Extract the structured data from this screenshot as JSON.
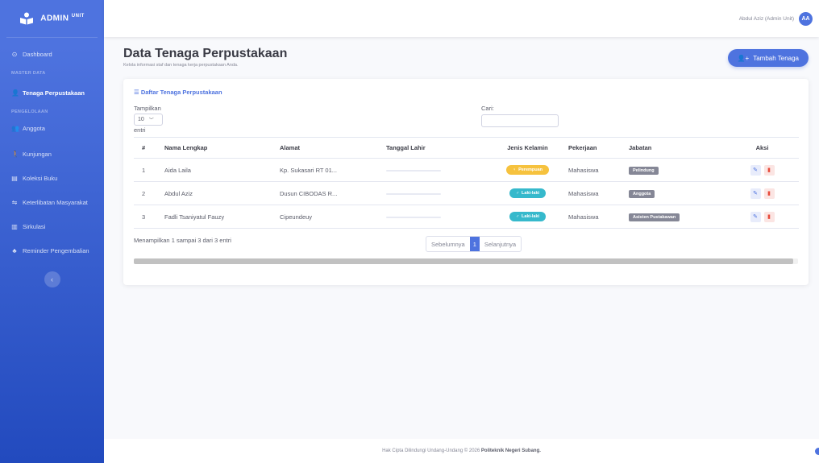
{
  "brand": {
    "name": "ADMIN",
    "suffix": "UNIT"
  },
  "sidebar": {
    "dashboard": "Dashboard",
    "heading_master": "MASTER DATA",
    "tenaga": "Tenaga Perpustakaan",
    "heading_pengelolaan": "PENGELOLAAN",
    "items": [
      "Anggota",
      "Kunjungan",
      "Koleksi Buku",
      "Keterlibatan Masyarakat",
      "Sirkulasi",
      "Reminder Pengembalian"
    ]
  },
  "topbar": {
    "user_name": "Abdul Aziz (Admin Unit)",
    "avatar": "AA"
  },
  "page": {
    "title": "Data Tenaga Perpustakaan",
    "subtitle": "Kelola informasi staf dan tenaga kerja perpustakaan Anda.",
    "add_button": "Tambah Tenaga"
  },
  "card": {
    "title": "Daftar Tenaga Perpustakaan",
    "show_label": "Tampilkan",
    "show_value": "10",
    "entries_label": "entri",
    "search_label": "Cari:"
  },
  "table": {
    "headers": [
      "#",
      "Nama Lengkap",
      "Alamat",
      "Tanggal Lahir",
      "Jenis Kelamin",
      "Pekerjaan",
      "Jabatan",
      "Aksi"
    ],
    "rows": [
      {
        "no": "1",
        "name": "Aida Laila",
        "address": "Kp. Sukasari RT 01...",
        "gender": "Perempuan",
        "job": "Mahasiswa",
        "position": "Pelindung"
      },
      {
        "no": "2",
        "name": "Abdul Aziz",
        "address": "Dusun CIBODAS R...",
        "gender": "Laki-laki",
        "job": "Mahasiswa",
        "position": "Anggota"
      },
      {
        "no": "3",
        "name": "Fadli Tsaniyatul Fauzy",
        "address": "Cipeundeuy",
        "gender": "Laki-laki",
        "job": "Mahasiswa",
        "position": "Asisten Pustakawan"
      }
    ]
  },
  "pagination": {
    "info": "Menampilkan 1 sampai 3 dari 3 entri",
    "prev": "Sebelumnya",
    "current": "1",
    "next": "Selanjutnya"
  },
  "footer": {
    "text": "Hak Cipta Dilindungi Undang-Undang © 2026",
    "org": "Politeknik Negeri Subang."
  },
  "colors": {
    "primary": "#4e73df",
    "female": "#f6c23e",
    "male": "#36b9cc",
    "danger": "#e74a3b"
  }
}
